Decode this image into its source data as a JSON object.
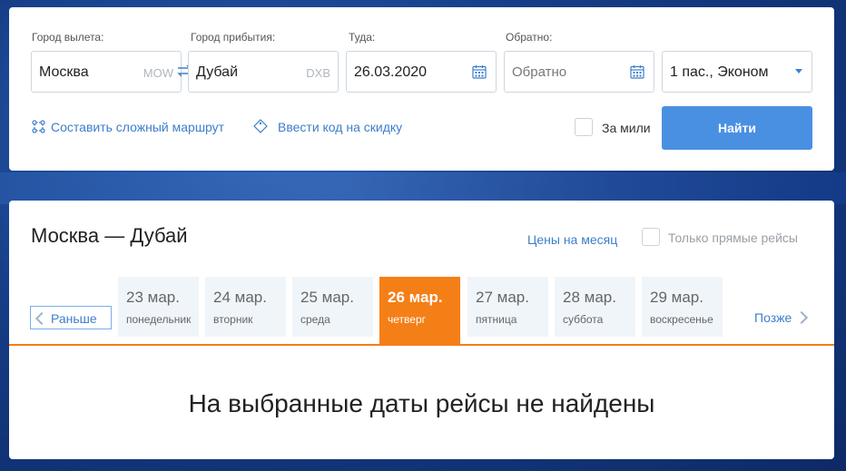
{
  "search": {
    "from": {
      "label": "Город вылета:",
      "value": "Москва",
      "code": "MOW"
    },
    "to": {
      "label": "Город прибытия:",
      "value": "Дубай",
      "code": "DXB"
    },
    "depart": {
      "label": "Туда:",
      "value": "26.03.2020"
    },
    "return": {
      "label": "Обратно:",
      "placeholder": "Обратно"
    },
    "passengers": {
      "value": "1 пас., Эконом"
    },
    "complex_route_label": "Составить сложный маршрут",
    "promo_label": "Ввести код на скидку",
    "miles_label": "За мили",
    "find_label": "Найти"
  },
  "results": {
    "title": "Москва — Дубай",
    "month_prices_label": "Цены на месяц",
    "direct_only_label": "Только прямые рейсы",
    "prev_label": "Раньше",
    "next_label": "Позже",
    "days": [
      {
        "date": "23 мар.",
        "weekday": "понедельник"
      },
      {
        "date": "24 мар.",
        "weekday": "вторник"
      },
      {
        "date": "25 мар.",
        "weekday": "среда"
      },
      {
        "date": "26 мар.",
        "weekday": "четверг",
        "active": true
      },
      {
        "date": "27 мар.",
        "weekday": "пятница"
      },
      {
        "date": "28 мар.",
        "weekday": "суббота"
      },
      {
        "date": "29 мар.",
        "weekday": "воскресенье"
      }
    ],
    "empty_message": "На выбранные даты рейсы не найдены"
  },
  "colors": {
    "accent": "#4a90e2",
    "active_day": "#f47f17",
    "link": "#3d7ecb"
  }
}
